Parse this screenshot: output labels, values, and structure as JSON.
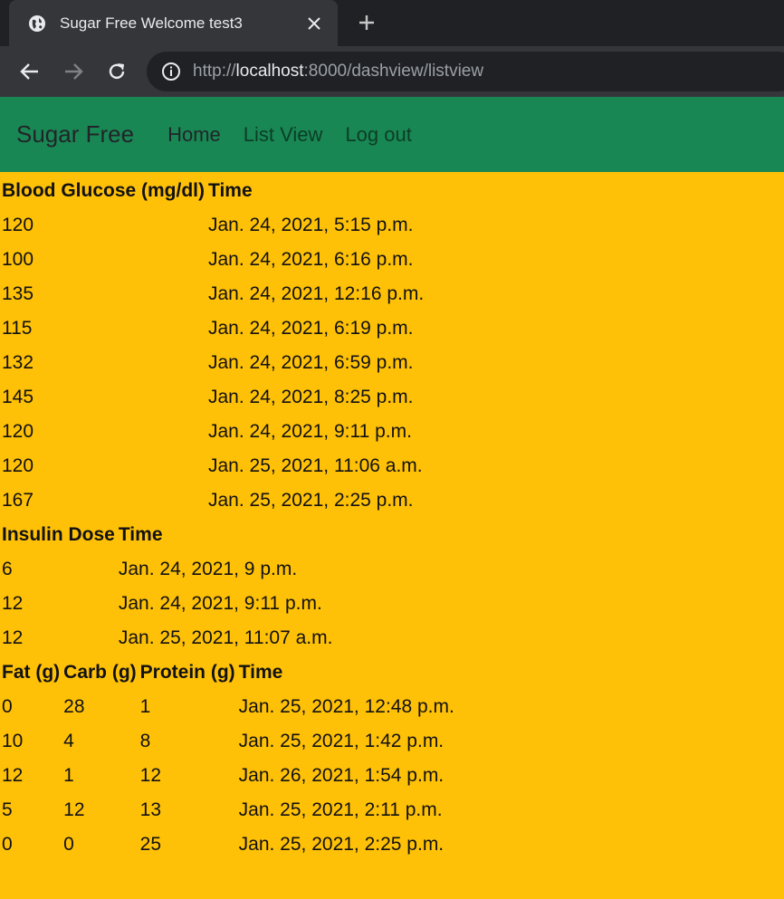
{
  "browser": {
    "tab_title": "Sugar Free Welcome test3",
    "url_scheme": "http://",
    "url_host": "localhost",
    "url_rest": ":8000/dashview/listview"
  },
  "nav": {
    "brand": "Sugar Free",
    "links": [
      "Home",
      "List View",
      "Log out"
    ]
  },
  "glucose_table": {
    "headers": [
      "Blood Glucose (mg/dl)",
      "Time"
    ],
    "rows": [
      [
        "120",
        "Jan. 24, 2021, 5:15 p.m."
      ],
      [
        "100",
        "Jan. 24, 2021, 6:16 p.m."
      ],
      [
        "135",
        "Jan. 24, 2021, 12:16 p.m."
      ],
      [
        "115",
        "Jan. 24, 2021, 6:19 p.m."
      ],
      [
        "132",
        "Jan. 24, 2021, 6:59 p.m."
      ],
      [
        "145",
        "Jan. 24, 2021, 8:25 p.m."
      ],
      [
        "120",
        "Jan. 24, 2021, 9:11 p.m."
      ],
      [
        "120",
        "Jan. 25, 2021, 11:06 a.m."
      ],
      [
        "167",
        "Jan. 25, 2021, 2:25 p.m."
      ]
    ]
  },
  "insulin_table": {
    "headers": [
      "Insulin Dose",
      "Time"
    ],
    "rows": [
      [
        "6",
        "Jan. 24, 2021, 9 p.m."
      ],
      [
        "12",
        "Jan. 24, 2021, 9:11 p.m."
      ],
      [
        "12",
        "Jan. 25, 2021, 11:07 a.m."
      ]
    ]
  },
  "food_table": {
    "headers": [
      "Fat (g)",
      "Carb (g)",
      "Protein (g)",
      "Time"
    ],
    "rows": [
      [
        "0",
        "28",
        "1",
        "Jan. 25, 2021, 12:48 p.m."
      ],
      [
        "10",
        "4",
        "8",
        "Jan. 25, 2021, 1:42 p.m."
      ],
      [
        "12",
        "1",
        "12",
        "Jan. 26, 2021, 1:54 p.m."
      ],
      [
        "5",
        "12",
        "13",
        "Jan. 25, 2021, 2:11 p.m."
      ],
      [
        "0",
        "0",
        "25",
        "Jan. 25, 2021, 2:25 p.m."
      ]
    ]
  },
  "colors": {
    "navbar_bg": "#198754",
    "page_bg": "#ffc107"
  }
}
